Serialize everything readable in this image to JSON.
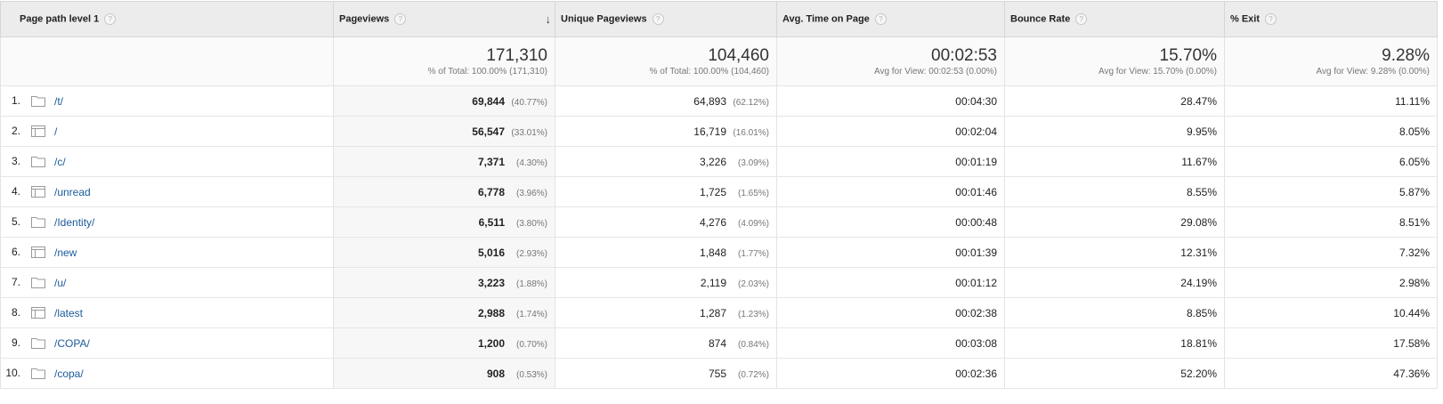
{
  "headers": {
    "page_path": "Page path level 1",
    "pageviews": "Pageviews",
    "unique_pageviews": "Unique Pageviews",
    "avg_time": "Avg. Time on Page",
    "bounce_rate": "Bounce Rate",
    "exit": "% Exit",
    "help": "?",
    "sort_arrow": "↓"
  },
  "totals": {
    "pageviews": {
      "value": "171,310",
      "sub": "% of Total: 100.00% (171,310)"
    },
    "unique_pageviews": {
      "value": "104,460",
      "sub": "% of Total: 100.00% (104,460)"
    },
    "avg_time": {
      "value": "00:02:53",
      "sub": "Avg for View: 00:02:53 (0.00%)"
    },
    "bounce_rate": {
      "value": "15.70%",
      "sub": "Avg for View: 15.70% (0.00%)"
    },
    "exit": {
      "value": "9.28%",
      "sub": "Avg for View: 9.28% (0.00%)"
    }
  },
  "rows": [
    {
      "num": "1.",
      "icon": "folder-icon",
      "path": "/t/",
      "pageviews": "69,844",
      "pageviews_pct": "(40.77%)",
      "unique": "64,893",
      "unique_pct": "(62.12%)",
      "avg_time": "00:04:30",
      "bounce": "28.47%",
      "exit": "11.11%"
    },
    {
      "num": "2.",
      "icon": "page-icon",
      "path": "/",
      "pageviews": "56,547",
      "pageviews_pct": "(33.01%)",
      "unique": "16,719",
      "unique_pct": "(16.01%)",
      "avg_time": "00:02:04",
      "bounce": "9.95%",
      "exit": "8.05%"
    },
    {
      "num": "3.",
      "icon": "folder-icon",
      "path": "/c/",
      "pageviews": "7,371",
      "pageviews_pct": "(4.30%)",
      "unique": "3,226",
      "unique_pct": "(3.09%)",
      "avg_time": "00:01:19",
      "bounce": "11.67%",
      "exit": "6.05%"
    },
    {
      "num": "4.",
      "icon": "page-icon",
      "path": "/unread",
      "pageviews": "6,778",
      "pageviews_pct": "(3.96%)",
      "unique": "1,725",
      "unique_pct": "(1.65%)",
      "avg_time": "00:01:46",
      "bounce": "8.55%",
      "exit": "5.87%"
    },
    {
      "num": "5.",
      "icon": "folder-icon",
      "path": "/Identity/",
      "pageviews": "6,511",
      "pageviews_pct": "(3.80%)",
      "unique": "4,276",
      "unique_pct": "(4.09%)",
      "avg_time": "00:00:48",
      "bounce": "29.08%",
      "exit": "8.51%"
    },
    {
      "num": "6.",
      "icon": "page-icon",
      "path": "/new",
      "pageviews": "5,016",
      "pageviews_pct": "(2.93%)",
      "unique": "1,848",
      "unique_pct": "(1.77%)",
      "avg_time": "00:01:39",
      "bounce": "12.31%",
      "exit": "7.32%"
    },
    {
      "num": "7.",
      "icon": "folder-icon",
      "path": "/u/",
      "pageviews": "3,223",
      "pageviews_pct": "(1.88%)",
      "unique": "2,119",
      "unique_pct": "(2.03%)",
      "avg_time": "00:01:12",
      "bounce": "24.19%",
      "exit": "2.98%"
    },
    {
      "num": "8.",
      "icon": "page-icon",
      "path": "/latest",
      "pageviews": "2,988",
      "pageviews_pct": "(1.74%)",
      "unique": "1,287",
      "unique_pct": "(1.23%)",
      "avg_time": "00:02:38",
      "bounce": "8.85%",
      "exit": "10.44%"
    },
    {
      "num": "9.",
      "icon": "folder-icon",
      "path": "/COPA/",
      "pageviews": "1,200",
      "pageviews_pct": "(0.70%)",
      "unique": "874",
      "unique_pct": "(0.84%)",
      "avg_time": "00:03:08",
      "bounce": "18.81%",
      "exit": "17.58%"
    },
    {
      "num": "10.",
      "icon": "folder-icon",
      "path": "/copa/",
      "pageviews": "908",
      "pageviews_pct": "(0.53%)",
      "unique": "755",
      "unique_pct": "(0.72%)",
      "avg_time": "00:02:36",
      "bounce": "52.20%",
      "exit": "47.36%"
    }
  ],
  "colors": {
    "link": "#1a5a9a",
    "header_bg": "#ececec",
    "icon": "#9a9a9a"
  }
}
